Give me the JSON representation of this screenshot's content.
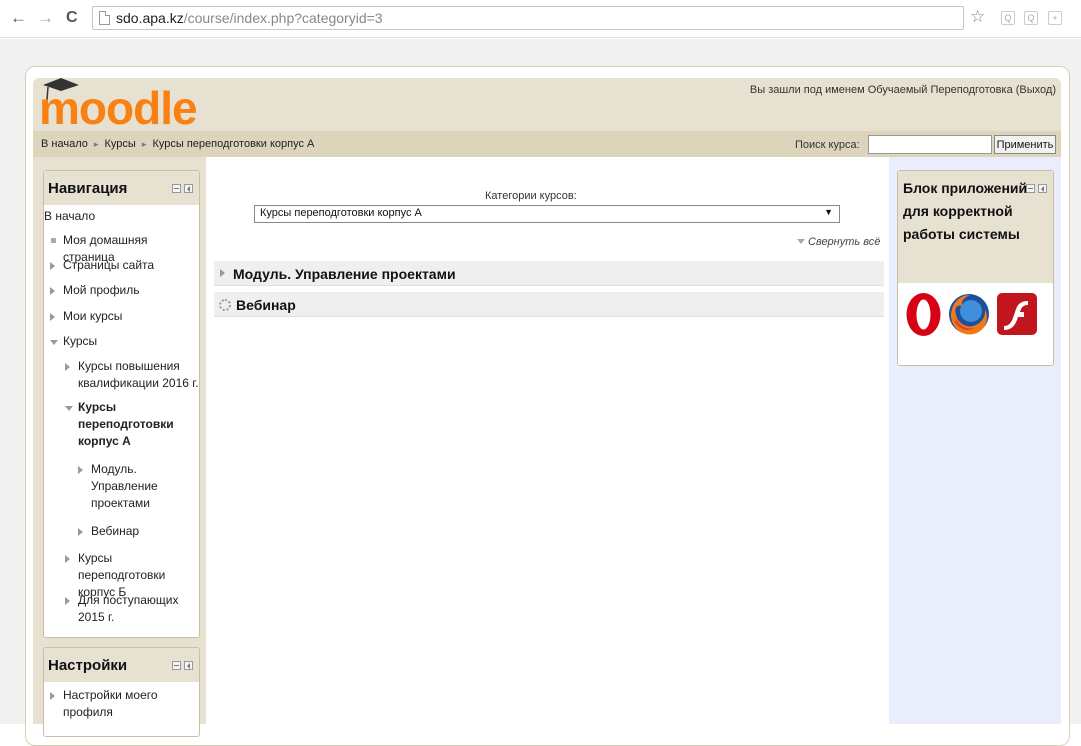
{
  "browser": {
    "back_glyph": "←",
    "forward_glyph": "→",
    "reload_glyph": "C",
    "url_host": "sdo.apa.kz",
    "url_path": "/course/index.php?categoryid=3",
    "bookmark_glyph": "☆",
    "extensions": [
      "Q",
      "Q",
      "+"
    ]
  },
  "header": {
    "logo_text": "moodle",
    "login_info": "Вы зашли под именем Обучаемый Переподготовка (Выход)"
  },
  "navbar": {
    "breadcrumb": [
      "В начало",
      "Курсы",
      "Курсы переподготовки корпус А"
    ],
    "breadcrumb_sep": "▸",
    "search_label": "Поиск курса:",
    "search_value": "",
    "search_button": "Применить"
  },
  "navigation": {
    "title": "Навигация",
    "items": [
      {
        "label": "В начало"
      },
      {
        "label": "Моя домашняя страница"
      },
      {
        "label": "Страницы сайта"
      },
      {
        "label": "Мой профиль"
      },
      {
        "label": "Мои курсы"
      },
      {
        "label": "Курсы"
      },
      {
        "label": "Курсы повышения квалификации 2016 г."
      },
      {
        "label": "Курсы переподготовки корпус А"
      },
      {
        "label": "Модуль. Управление проектами"
      },
      {
        "label": "Вебинар"
      },
      {
        "label": "Курсы переподготовки корпус Б"
      },
      {
        "label": "Для поступающих 2015 г."
      }
    ]
  },
  "settings": {
    "title": "Настройки",
    "items": [
      {
        "label": "Настройки моего профиля"
      }
    ]
  },
  "main": {
    "categories_label": "Категории курсов:",
    "selected_category": "Курсы переподготовки корпус А",
    "select_arrow": "▼",
    "collapse_all": "Свернуть всё",
    "rows": [
      {
        "label": "Модуль. Управление проектами"
      },
      {
        "label": "Вебинар"
      }
    ]
  },
  "apps_block": {
    "title": "Блок приложений для корректной работы системы",
    "icons": [
      "opera-icon",
      "firefox-icon",
      "flash-player-icon"
    ]
  },
  "colors": {
    "header_bg": "#e6e1d1",
    "navbar_bg": "#dcd4bb",
    "right_column_bg": "#eaedfc",
    "logo_orange": "#f98012",
    "opera_red": "#d70015",
    "flash_red": "#c1161d"
  }
}
